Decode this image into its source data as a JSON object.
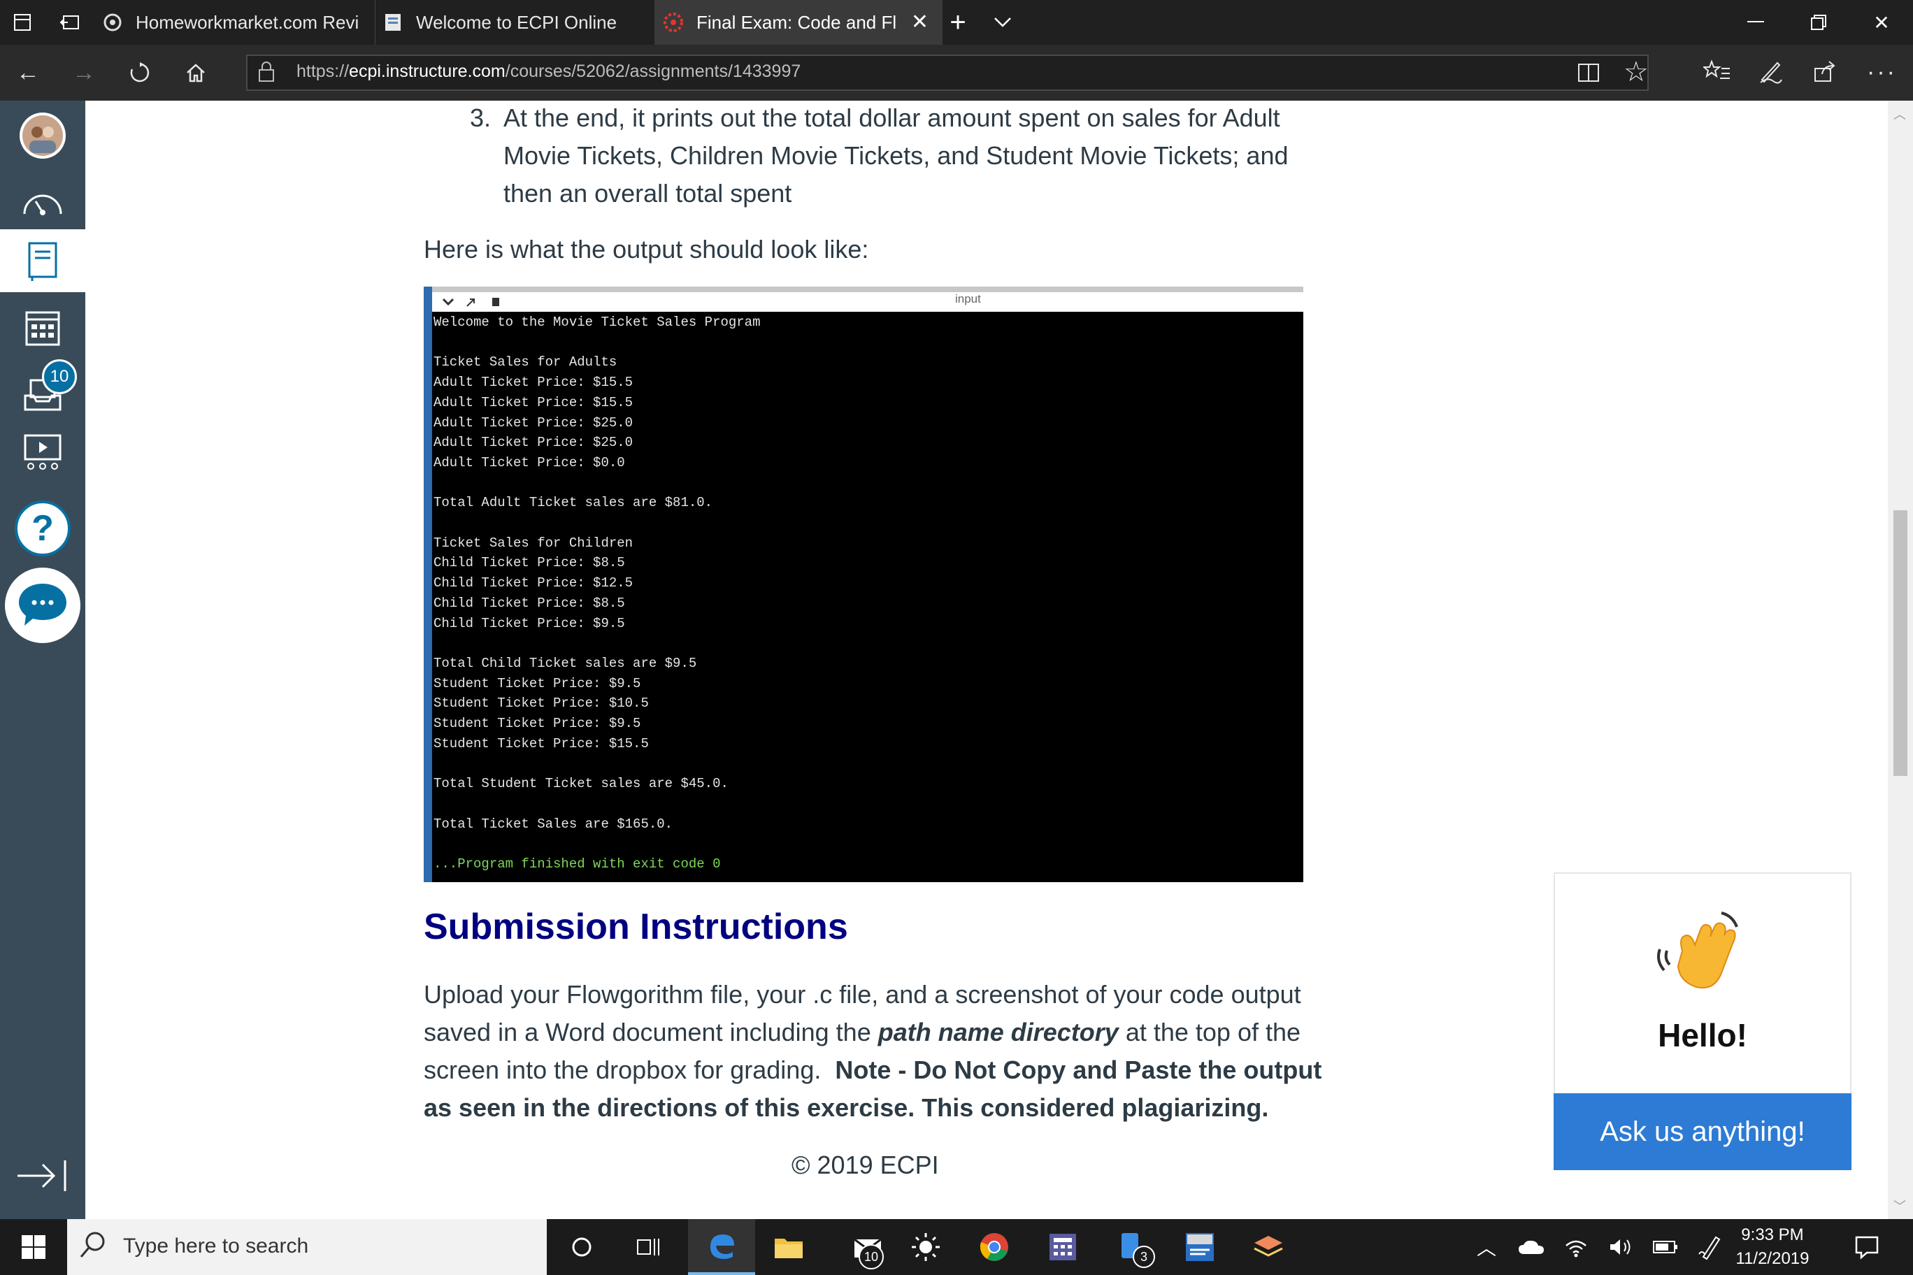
{
  "browser": {
    "tabs": [
      {
        "label": "Homeworkmarket.com Revi"
      },
      {
        "label": "Welcome to ECPI Online"
      },
      {
        "label": "Final Exam: Code and Fl"
      }
    ],
    "url_prefix": "https://",
    "url_domain": "ecpi.instructure.com",
    "url_path": "/courses/52062/assignments/1433997"
  },
  "leftnav": {
    "inbox_badge": "10",
    "help_label": "?"
  },
  "content": {
    "list_number": "3.",
    "list_text_1": "At the end, it prints out the total dollar amount spent on sales for Adult",
    "list_text_2": "Movie Tickets, Children Movie Tickets, and Student Movie Tickets; and",
    "list_text_3": "then an overall total spent",
    "output_intro": "Here is what the output should look like:",
    "console_header_label": "input",
    "console_lines": [
      "Welcome to the Movie Ticket Sales Program",
      "",
      "Ticket Sales for Adults",
      "Adult Ticket Price: $15.5",
      "Adult Ticket Price: $15.5",
      "Adult Ticket Price: $25.0",
      "Adult Ticket Price: $25.0",
      "Adult Ticket Price: $0.0",
      "",
      "Total Adult Ticket sales are $81.0.",
      "",
      "Ticket Sales for Children",
      "Child Ticket Price: $8.5",
      "Child Ticket Price: $12.5",
      "Child Ticket Price: $8.5",
      "Child Ticket Price: $9.5",
      "",
      "Total Child Ticket sales are $9.5",
      "Student Ticket Price: $9.5",
      "Student Ticket Price: $10.5",
      "Student Ticket Price: $9.5",
      "Student Ticket Price: $15.5",
      "",
      "Total Student Ticket sales are $45.0.",
      "",
      "Total Ticket Sales are $165.0.",
      "",
      "...Program finished with exit code 0"
    ],
    "heading": "Submission Instructions",
    "sub_1a": "Upload your Flowgorithm file, your .c file, and a screenshot of your code output",
    "sub_2a": "saved in a Word document including the ",
    "sub_2b": "path name directory",
    "sub_2c": " at the top of the",
    "sub_3a": "screen into the dropbox for grading.  ",
    "sub_3b": "Note - Do Not Copy and Paste the output",
    "sub_4": "as seen in the directions of this exercise. This considered plagiarizing.",
    "copyright": "© 2019 ECPI"
  },
  "chat": {
    "hello": "Hello!",
    "button": "Ask us anything!"
  },
  "taskbar": {
    "search_placeholder": "Type here to search",
    "mail_badge": "10",
    "app_badge": "3",
    "time": "9:33 PM",
    "date": "11/2/2019"
  },
  "colors": {
    "canvas_nav": "#394b58",
    "heading": "#000080",
    "chat_button": "#2d7bd4"
  }
}
